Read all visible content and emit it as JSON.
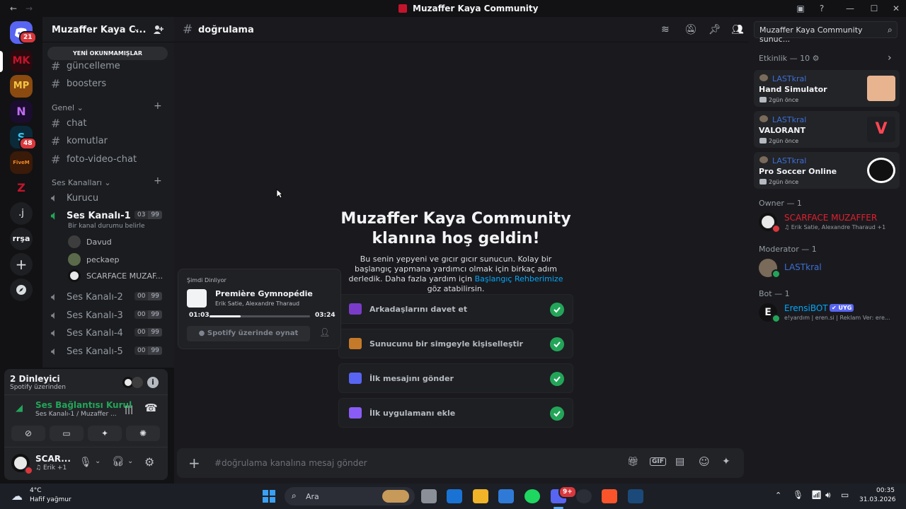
{
  "window": {
    "title": "Muzaffer Kaya Community"
  },
  "rail": {
    "home_badge": "21",
    "server_badge": "48",
    "servers": [
      "MK",
      "MP",
      "N",
      "S",
      "FiveM Base",
      "Z",
      ".j",
      "rrşa"
    ]
  },
  "sidebar": {
    "server_name": "Muzaffer Kaya C...",
    "unread_pill": "YENİ OKUNMAMIŞLAR",
    "top_channels": [
      "güncelleme",
      "boosters"
    ],
    "category_general": "Genel",
    "general_channels": [
      "chat",
      "komutlar",
      "foto-video-chat"
    ],
    "category_voice": "Ses Kanalları",
    "voice_channels": [
      {
        "name": "Kurucu"
      },
      {
        "name": "Ses Kanalı-1",
        "users": "03",
        "limit": "99",
        "status": "Bir kanal durumu belirle"
      },
      {
        "name": "Ses Kanalı-2",
        "users": "00",
        "limit": "99"
      },
      {
        "name": "Ses Kanalı-3",
        "users": "00",
        "limit": "99"
      },
      {
        "name": "Ses Kanalı-4",
        "users": "00",
        "limit": "99"
      },
      {
        "name": "Ses Kanalı-5",
        "users": "00",
        "limit": "99"
      }
    ],
    "voice_members": [
      "Davud",
      "peckaep",
      "SCARFACE MUZAF..."
    ]
  },
  "user_panel": {
    "listeners": "2 Dinleyici",
    "listeners_sub": "Spotify üzerinden",
    "voice_connected": "Ses Bağlantısı Kurul",
    "voice_location": "Ses Kanalı-1 / Muzaffer ...",
    "username": "SCAR...",
    "user_status": "Erik",
    "user_status_more": "+1"
  },
  "main": {
    "channel_name": "doğrulama",
    "welcome_title_1": "Muzaffer Kaya Community",
    "welcome_title_2": "klanına hoş geldin!",
    "welcome_desc_1": "Bu senin yepyeni ve gıcır gıcır sunucun. Kolay bir başlangıç yapmana yardımcı olmak için birkaç adım derledik. Daha fazla yardım için",
    "welcome_link": "Başlangıç Rehberimize",
    "welcome_desc_2": "göz atabilirsin.",
    "tasks": [
      "Arkadaşlarını davet et",
      "Sunucunu bir simgeyle kişiselleştir",
      "İlk mesajını gönder",
      "İlk uygulamanı ekle"
    ],
    "composer_placeholder": "#doğrulama kanalına mesaj gönder"
  },
  "now_playing": {
    "header": "Şimdi Dinliyor",
    "track": "Première Gymnopédie",
    "artist": "Erik Satie, Alexandre Tharaud",
    "elapsed": "01:03",
    "duration": "03:24",
    "progress": 0.31,
    "play_button": "Spotify üzerinde oynat"
  },
  "members": {
    "search": "Muzaffer Kaya Community sunuc...",
    "activity_header": "Etkinlik — 10",
    "activities": [
      {
        "user": "LASTkral",
        "game": "Hand Simulator",
        "time": "2gün önce"
      },
      {
        "user": "LASTkral",
        "game": "VALORANT",
        "time": "2gün önce"
      },
      {
        "user": "LASTkral",
        "game": "Pro Soccer Online",
        "time": "2gün önce"
      }
    ],
    "owner_header": "Owner — 1",
    "owner_name": "SCARFACE MUZAFFER",
    "owner_status": "Erik Satie, Alexandre Tharaud +1",
    "moderator_header": "Moderator — 1",
    "moderator_name": "LASTkral",
    "bot_header": "Bot — 1",
    "bot_name": "ErensiBOT",
    "bot_tag": "UYG",
    "bot_status": "e!yardım | eren.si | Reklam Ver: ere..."
  },
  "taskbar": {
    "temp": "4°C",
    "weather": "Hafif yağmur",
    "search": "Ara",
    "time": "00:35",
    "date": "31.03.2026",
    "discord_badge": "9+"
  },
  "colors": {
    "accent": "#5865f2",
    "online": "#23a559",
    "danger": "#da373c",
    "owner_red": "#e0202e",
    "link": "#00a8fc"
  }
}
